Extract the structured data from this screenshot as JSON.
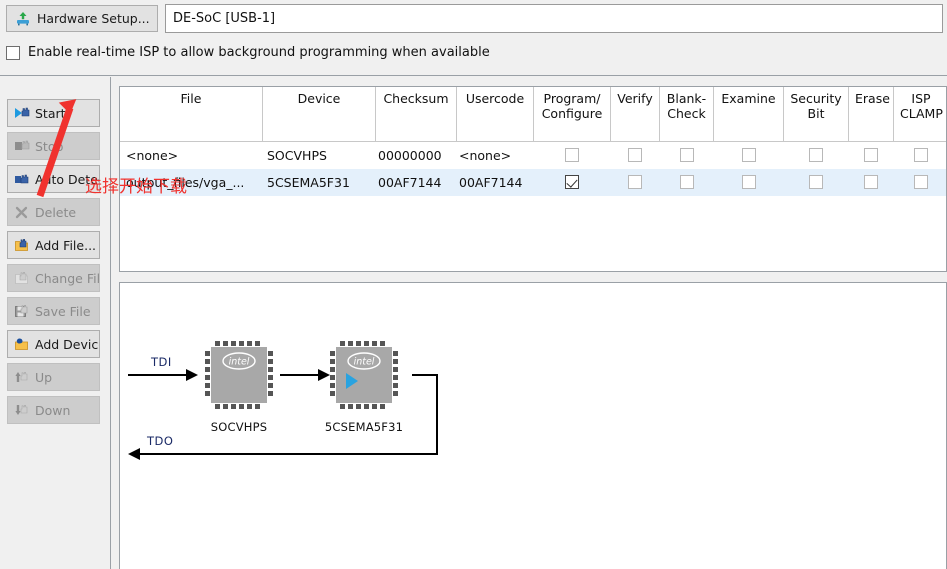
{
  "toolbar": {
    "hardware_setup_label": "Hardware Setup...",
    "hardware_setup_icon": "hardware-setup-icon",
    "cable_value": "DE-SoC [USB-1]"
  },
  "isp_option": {
    "label": "Enable real-time ISP to allow background programming when available",
    "checked": false
  },
  "sidebar": {
    "buttons": [
      {
        "label": "Start",
        "icon": "play-icon",
        "enabled": true
      },
      {
        "label": "Stop",
        "icon": "stop-icon",
        "enabled": false
      },
      {
        "label": "Auto Detect",
        "icon": "auto-detect-icon",
        "enabled": true
      },
      {
        "label": "Delete",
        "icon": "delete-x-icon",
        "enabled": false
      },
      {
        "label": "Add File...",
        "icon": "folder-add-icon",
        "enabled": true
      },
      {
        "label": "Change File",
        "icon": "folder-change-icon",
        "enabled": false
      },
      {
        "label": "Save File",
        "icon": "floppy-save-icon",
        "enabled": false
      },
      {
        "label": "Add Device",
        "icon": "chip-add-icon",
        "enabled": true
      },
      {
        "label": "Up",
        "icon": "arrow-up-icon",
        "enabled": false
      },
      {
        "label": "Down",
        "icon": "arrow-down-icon",
        "enabled": false
      }
    ]
  },
  "table": {
    "columns": [
      {
        "line1": "File",
        "line2": ""
      },
      {
        "line1": "Device",
        "line2": ""
      },
      {
        "line1": "Checksum",
        "line2": ""
      },
      {
        "line1": "Usercode",
        "line2": ""
      },
      {
        "line1": "Program/",
        "line2": "Configure"
      },
      {
        "line1": "Verify",
        "line2": ""
      },
      {
        "line1": "Blank-",
        "line2": "Check"
      },
      {
        "line1": "Examine",
        "line2": ""
      },
      {
        "line1": "Security",
        "line2": "Bit"
      },
      {
        "line1": "Erase",
        "line2": ""
      },
      {
        "line1": "ISP",
        "line2": "CLAMP"
      }
    ],
    "rows": [
      {
        "selected": false,
        "file": "<none>",
        "device": "SOCVHPS",
        "checksum": "00000000",
        "usercode": "<none>",
        "program_configure": false,
        "verify": false,
        "blank_check": false,
        "examine": false,
        "security_bit": false,
        "erase": false,
        "isp_clamp": false
      },
      {
        "selected": true,
        "file": "output_files/vga_...",
        "device": "5CSEMA5F31",
        "checksum": "00AF7144",
        "usercode": "00AF7144",
        "program_configure": true,
        "verify": false,
        "blank_check": false,
        "examine": false,
        "security_bit": false,
        "erase": false,
        "isp_clamp": false
      }
    ]
  },
  "diagram": {
    "tdi_label": "TDI",
    "tdo_label": "TDO",
    "devices": [
      {
        "name": "SOCVHPS",
        "logo": "intel",
        "has_blue_triangle": false
      },
      {
        "name": "5CSEMA5F31",
        "logo": "intel",
        "has_blue_triangle": true
      }
    ]
  },
  "annotation": {
    "text": "选择开始下载",
    "color": "#f0322e",
    "arrow": "red-arrow-pointing-to-start-button"
  }
}
